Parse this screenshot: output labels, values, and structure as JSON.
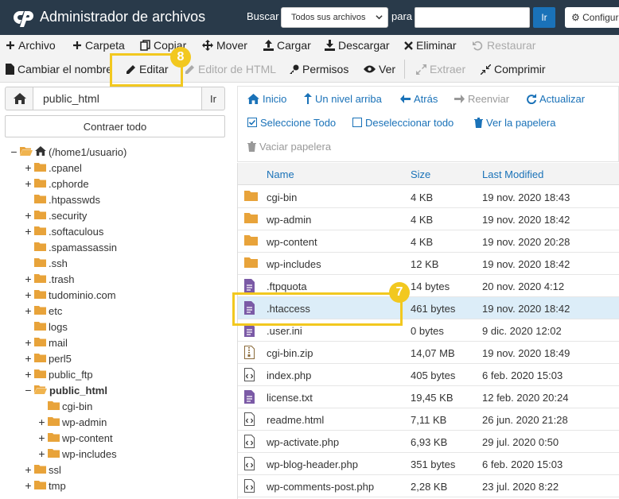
{
  "header": {
    "title": "Administrador de archivos",
    "search_label": "Buscar",
    "search_scope": "Todos sus archivos",
    "for_label": "para",
    "search_value": "",
    "go_label": "Ir",
    "config_label": "Configura"
  },
  "toolbar": {
    "row1": [
      {
        "key": "file",
        "label": "Archivo",
        "icon": "plus-icon",
        "enabled": true
      },
      {
        "key": "folder",
        "label": "Carpeta",
        "icon": "plus-icon",
        "enabled": true
      },
      {
        "key": "copy",
        "label": "Copiar",
        "icon": "copy-icon",
        "enabled": true
      },
      {
        "key": "move",
        "label": "Mover",
        "icon": "move-icon",
        "enabled": true
      },
      {
        "key": "upload",
        "label": "Cargar",
        "icon": "upload-icon",
        "enabled": true
      },
      {
        "key": "download",
        "label": "Descargar",
        "icon": "download-icon",
        "enabled": true
      },
      {
        "key": "delete",
        "label": "Eliminar",
        "icon": "close-icon",
        "enabled": true
      },
      {
        "key": "restore",
        "label": "Restaurar",
        "icon": "undo-icon",
        "enabled": false
      }
    ],
    "row2": [
      {
        "key": "rename",
        "label": "Cambiar el nombre",
        "icon": "file-icon",
        "enabled": true
      },
      {
        "key": "edit",
        "label": "Editar",
        "icon": "pencil-icon",
        "enabled": true
      },
      {
        "key": "html-editor",
        "label": "Editor de HTML",
        "icon": "pencil-icon",
        "enabled": false
      },
      {
        "key": "permissions",
        "label": "Permisos",
        "icon": "key-icon",
        "enabled": true
      },
      {
        "key": "view",
        "label": "Ver",
        "icon": "eye-icon",
        "enabled": true
      },
      {
        "key": "extract",
        "label": "Extraer",
        "icon": "expand-icon",
        "enabled": false
      },
      {
        "key": "compress",
        "label": "Comprimir",
        "icon": "compress-icon",
        "enabled": true
      }
    ]
  },
  "callouts": {
    "edit_step": "8",
    "htaccess_step": "7",
    "color": "#f2c81f"
  },
  "left": {
    "path_value": "public_html",
    "go_label": "Ir",
    "collapse_label": "Contraer todo",
    "tree": [
      {
        "label": "(/home1/usuario)",
        "depth": 0,
        "toggle": "−",
        "open": true,
        "home": true
      },
      {
        "label": ".cpanel",
        "depth": 1,
        "toggle": "+"
      },
      {
        "label": ".cphorde",
        "depth": 1,
        "toggle": "+"
      },
      {
        "label": ".htpasswds",
        "depth": 1,
        "toggle": ""
      },
      {
        "label": ".security",
        "depth": 1,
        "toggle": "+"
      },
      {
        "label": ".softaculous",
        "depth": 1,
        "toggle": "+"
      },
      {
        "label": ".spamassassin",
        "depth": 1,
        "toggle": ""
      },
      {
        "label": ".ssh",
        "depth": 1,
        "toggle": ""
      },
      {
        "label": ".trash",
        "depth": 1,
        "toggle": "+"
      },
      {
        "label": "tudominio.com",
        "depth": 1,
        "toggle": "+"
      },
      {
        "label": "etc",
        "depth": 1,
        "toggle": "+"
      },
      {
        "label": "logs",
        "depth": 1,
        "toggle": ""
      },
      {
        "label": "mail",
        "depth": 1,
        "toggle": "+"
      },
      {
        "label": "perl5",
        "depth": 1,
        "toggle": "+"
      },
      {
        "label": "public_ftp",
        "depth": 1,
        "toggle": "+"
      },
      {
        "label": "public_html",
        "depth": 1,
        "toggle": "−",
        "open": true,
        "bold": true
      },
      {
        "label": "cgi-bin",
        "depth": 2,
        "toggle": ""
      },
      {
        "label": "wp-admin",
        "depth": 2,
        "toggle": "+"
      },
      {
        "label": "wp-content",
        "depth": 2,
        "toggle": "+"
      },
      {
        "label": "wp-includes",
        "depth": 2,
        "toggle": "+"
      },
      {
        "label": "ssl",
        "depth": 1,
        "toggle": "+"
      },
      {
        "label": "tmp",
        "depth": 1,
        "toggle": "+"
      }
    ]
  },
  "nav": {
    "row1": [
      {
        "key": "home",
        "label": "Inicio",
        "icon": "home-icon"
      },
      {
        "key": "up",
        "label": "Un nivel arriba",
        "icon": "arrow-up-icon"
      },
      {
        "key": "back",
        "label": "Atrás",
        "icon": "arrow-left-icon"
      },
      {
        "key": "forward",
        "label": "Reenviar",
        "icon": "arrow-right-icon",
        "disabled": true
      },
      {
        "key": "refresh",
        "label": "Actualizar",
        "icon": "refresh-icon"
      }
    ],
    "row2": [
      {
        "key": "select-all",
        "label": "Seleccione Todo",
        "icon": "checkbox-checked-icon"
      },
      {
        "key": "deselect-all",
        "label": "Deseleccionar todo",
        "icon": "checkbox-icon"
      },
      {
        "key": "view-trash",
        "label": "Ver la papelera",
        "icon": "trash-icon"
      }
    ],
    "row3": [
      {
        "key": "empty-trash",
        "label": "Vaciar papelera",
        "icon": "trash-icon",
        "disabled": true
      }
    ]
  },
  "table": {
    "columns": {
      "name": "Name",
      "size": "Size",
      "modified": "Last Modified"
    },
    "rows": [
      {
        "name": "cgi-bin",
        "size": "4 KB",
        "modified": "19 nov. 2020 18:43",
        "type": "folder"
      },
      {
        "name": "wp-admin",
        "size": "4 KB",
        "modified": "19 nov. 2020 18:42",
        "type": "folder"
      },
      {
        "name": "wp-content",
        "size": "4 KB",
        "modified": "19 nov. 2020 20:28",
        "type": "folder"
      },
      {
        "name": "wp-includes",
        "size": "12 KB",
        "modified": "19 nov. 2020 18:42",
        "type": "folder"
      },
      {
        "name": ".ftpquota",
        "size": "14 bytes",
        "modified": "20 nov. 2020 4:12",
        "type": "text"
      },
      {
        "name": ".htaccess",
        "size": "461 bytes",
        "modified": "19 nov. 2020 18:42",
        "type": "text",
        "selected": true
      },
      {
        "name": ".user.ini",
        "size": "0 bytes",
        "modified": "9 dic. 2020 12:02",
        "type": "text"
      },
      {
        "name": "cgi-bin.zip",
        "size": "14,07 MB",
        "modified": "19 nov. 2020 18:49",
        "type": "zip"
      },
      {
        "name": "index.php",
        "size": "405 bytes",
        "modified": "6 feb. 2020 15:03",
        "type": "code"
      },
      {
        "name": "license.txt",
        "size": "19,45 KB",
        "modified": "12 feb. 2020 20:24",
        "type": "text"
      },
      {
        "name": "readme.html",
        "size": "7,11 KB",
        "modified": "26 jun. 2020 21:28",
        "type": "code"
      },
      {
        "name": "wp-activate.php",
        "size": "6,93 KB",
        "modified": "29 jul. 2020 0:50",
        "type": "code"
      },
      {
        "name": "wp-blog-header.php",
        "size": "351 bytes",
        "modified": "6 feb. 2020 15:03",
        "type": "code"
      },
      {
        "name": "wp-comments-post.php",
        "size": "2,28 KB",
        "modified": "23 jul. 2020 8:22",
        "type": "code"
      }
    ]
  }
}
